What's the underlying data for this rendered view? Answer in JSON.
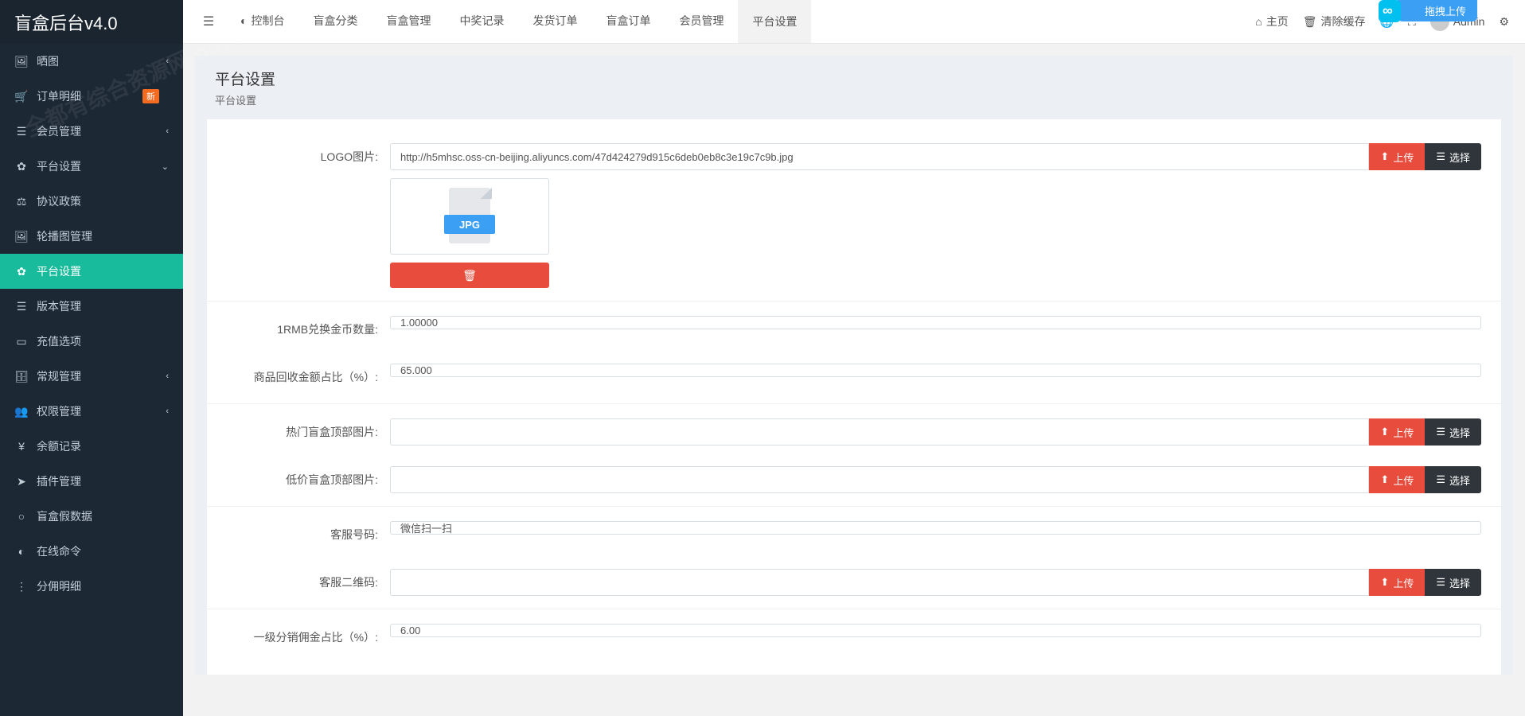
{
  "brand": "盲盒后台v4.0",
  "watermark": "全都有综合资源网 ouyovip.com",
  "float_badge": "拖拽上传",
  "topnav": {
    "tabs": [
      {
        "label": "控制台",
        "icon": "◐"
      },
      {
        "label": "盲盒分类"
      },
      {
        "label": "盲盒管理"
      },
      {
        "label": "中奖记录"
      },
      {
        "label": "发货订单"
      },
      {
        "label": "盲盒订单"
      },
      {
        "label": "会员管理"
      },
      {
        "label": "平台设置",
        "active": true
      }
    ],
    "right": {
      "home": "主页",
      "clear_cache": "清除缓存",
      "admin": "Admin"
    }
  },
  "sidebar": {
    "items": [
      {
        "icon": "🖼",
        "label": "晒图",
        "chev": "‹"
      },
      {
        "icon": "🛒",
        "label": "订单明细",
        "badge": "新"
      },
      {
        "icon": "☰",
        "label": "会员管理",
        "chev": "‹"
      },
      {
        "icon": "✿",
        "label": "平台设置",
        "chev": "⌄",
        "expanded": true
      },
      {
        "icon": "⚖",
        "label": "协议政策",
        "sub": true
      },
      {
        "icon": "🖼",
        "label": "轮播图管理",
        "sub": true
      },
      {
        "icon": "✿",
        "label": "平台设置",
        "sub": true,
        "active": true
      },
      {
        "icon": "☰",
        "label": "版本管理",
        "sub": true
      },
      {
        "icon": "▭",
        "label": "充值选项",
        "sub": true
      },
      {
        "icon": "🗄",
        "label": "常规管理",
        "chev": "‹"
      },
      {
        "icon": "👥",
        "label": "权限管理",
        "chev": "‹"
      },
      {
        "icon": "¥",
        "label": "余额记录"
      },
      {
        "icon": "➤",
        "label": "插件管理"
      },
      {
        "icon": "○",
        "label": "盲盒假数据"
      },
      {
        "icon": "◐",
        "label": "在线命令"
      },
      {
        "icon": "⋮",
        "label": "分佣明细"
      }
    ]
  },
  "page": {
    "title": "平台设置",
    "sub": "平台设置"
  },
  "form": {
    "logo": {
      "label": "LOGO图片:",
      "value": "http://h5mhsc.oss-cn-beijing.aliyuncs.com/47d424279d915c6deb0eb8c3e19c7c9b.jpg",
      "upload": "上传",
      "select": "选择",
      "thumb_ext": "JPG"
    },
    "rmb_rate": {
      "label": "1RMB兑换金币数量:",
      "value": "1.00000"
    },
    "recycle_pct": {
      "label": "商品回收金额占比（%）:",
      "value": "65.000"
    },
    "hot_img": {
      "label": "热门盲盒顶部图片:",
      "value": "",
      "upload": "上传",
      "select": "选择"
    },
    "cheap_img": {
      "label": "低价盲盒顶部图片:",
      "value": "",
      "upload": "上传",
      "select": "选择"
    },
    "service_no": {
      "label": "客服号码:",
      "value": "微信扫一扫"
    },
    "service_qr": {
      "label": "客服二维码:",
      "value": "",
      "upload": "上传",
      "select": "选择"
    },
    "commission1": {
      "label": "一级分销佣金占比（%）:",
      "value": "6.00"
    }
  }
}
